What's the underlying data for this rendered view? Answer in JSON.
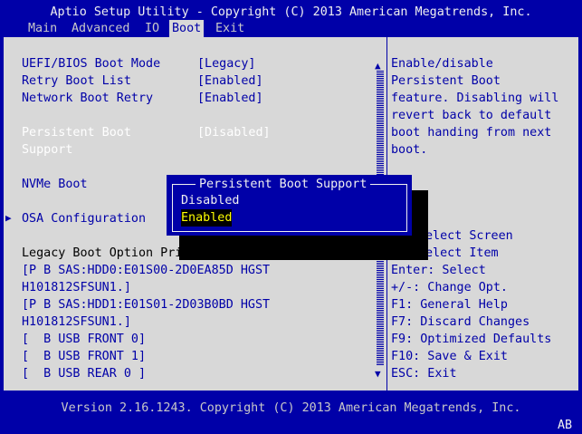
{
  "header": {
    "title": "Aptio Setup Utility - Copyright (C) 2013 American Megatrends, Inc."
  },
  "menu": [
    {
      "label": "Main"
    },
    {
      "label": "Advanced"
    },
    {
      "label": "IO"
    },
    {
      "label": "Boot",
      "active": true
    },
    {
      "label": "Exit"
    }
  ],
  "settings": [
    {
      "label": "UEFI/BIOS Boot Mode",
      "value": "[Legacy]"
    },
    {
      "label": "Retry Boot List",
      "value": "[Enabled]"
    },
    {
      "label": "Network Boot Retry",
      "value": "[Enabled]"
    },
    {
      "label": "Persistent Boot",
      "label2": "Support",
      "value": "[Disabled]"
    },
    {
      "label": "NVMe Boot"
    },
    {
      "label": "OSA Configuration"
    }
  ],
  "legacy": {
    "heading": "Legacy Boot Option Pri",
    "items": [
      "[P B SAS:HDD0:E01S00-2D0EA85D HGST",
      "H101812SFSUN1.]",
      "[P B SAS:HDD1:E01S01-2D03B0BD HGST",
      "H101812SFSUN1.]",
      "[  B USB FRONT 0]",
      "[  B USB FRONT 1]",
      "[  B USB REAR 0 ]"
    ]
  },
  "help": {
    "description": [
      "Enable/disable",
      "Persistent Boot",
      "feature. Disabling will",
      "revert back to default",
      "boot handing from next",
      "boot."
    ],
    "keys": [
      "elect Screen",
      "elect Item",
      "Enter: Select",
      "+/-: Change Opt.",
      "F1: General Help",
      "F7: Discard Changes",
      "F9: Optimized Defaults",
      "F10: Save & Exit",
      "ESC: Exit"
    ]
  },
  "popup": {
    "title": "Persistent Boot Support",
    "options": [
      "Disabled",
      "Enabled"
    ],
    "selected": "Enabled"
  },
  "footer": {
    "version": "Version 2.16.1243. Copyright (C) 2013 American Megatrends, Inc.",
    "badge": "AB"
  },
  "colors": {
    "background": "#0000a8",
    "panel": "#d8d8d8",
    "highlight": "#ffff00"
  }
}
